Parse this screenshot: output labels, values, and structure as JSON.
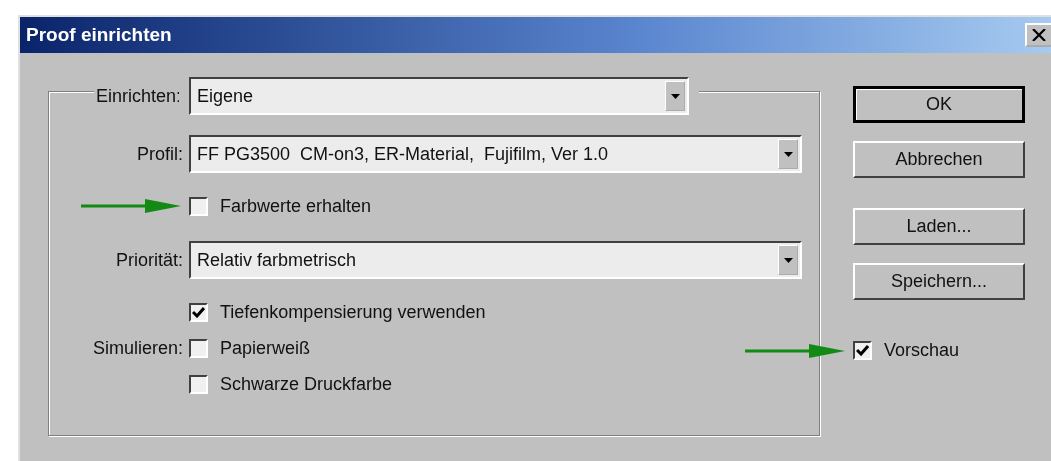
{
  "window": {
    "title": "Proof einrichten"
  },
  "settings": [
    {
      "kind": "select",
      "label": "Einrichten:",
      "value": "Eigene"
    },
    {
      "kind": "select",
      "label": "Profil:",
      "value": "FF PG3500  CM-on3, ER-Material,  Fujifilm, Ver 1.0"
    },
    {
      "kind": "checkbox",
      "label": "Farbwerte erhalten",
      "checked": false,
      "arrow": true
    },
    {
      "kind": "select",
      "label": "Priorität:",
      "value": "Relativ farbmetrisch"
    },
    {
      "kind": "checkbox",
      "label": "Tiefenkompensierung verwenden",
      "checked": true,
      "arrow": false
    },
    {
      "kind": "checkbox",
      "caption": "Simulieren:",
      "label": "Papierweiß",
      "checked": false,
      "arrow": false
    },
    {
      "kind": "checkbox",
      "label": "Schwarze Druckfarbe",
      "checked": false,
      "arrow": false
    }
  ],
  "buttons": [
    {
      "label": "OK",
      "default": true
    },
    {
      "label": "Abbrechen",
      "default": false
    },
    {
      "label": "Laden...",
      "default": false
    },
    {
      "label": "Speichern...",
      "default": false
    }
  ],
  "preview": {
    "label": "Vorschau",
    "checked": true,
    "arrow": true
  }
}
